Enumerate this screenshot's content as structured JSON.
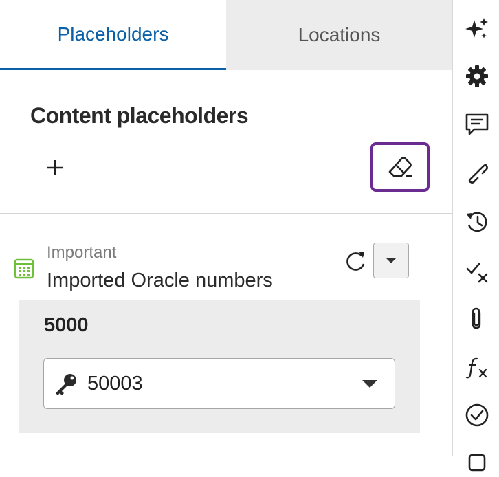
{
  "tabs": [
    {
      "label": "Placeholders",
      "active": true
    },
    {
      "label": "Locations",
      "active": false
    }
  ],
  "section": {
    "title": "Content placeholders",
    "add_icon": "plus-icon",
    "clear_icon": "eraser-icon"
  },
  "item": {
    "icon": "spreadsheet-icon",
    "category": "Important",
    "title": "Imported Oracle numbers",
    "refresh_icon": "refresh-icon",
    "menu_icon": "caret-down-icon",
    "value_label": "5000",
    "key_field": {
      "icon": "key-icon",
      "value": "50003",
      "arrow_icon": "caret-down-icon"
    }
  },
  "rail": [
    {
      "icon": "sparkle-icon"
    },
    {
      "icon": "gear-icon"
    },
    {
      "icon": "comment-icon"
    },
    {
      "icon": "link-icon"
    },
    {
      "icon": "history-icon"
    },
    {
      "icon": "check-x-icon"
    },
    {
      "icon": "paperclip-icon"
    },
    {
      "icon": "function-icon"
    },
    {
      "icon": "check-circle-icon"
    }
  ],
  "colors": {
    "accent": "#0b61a8",
    "focus_border": "#6b2c91",
    "spreadsheet_green": "#6fbf3a"
  }
}
